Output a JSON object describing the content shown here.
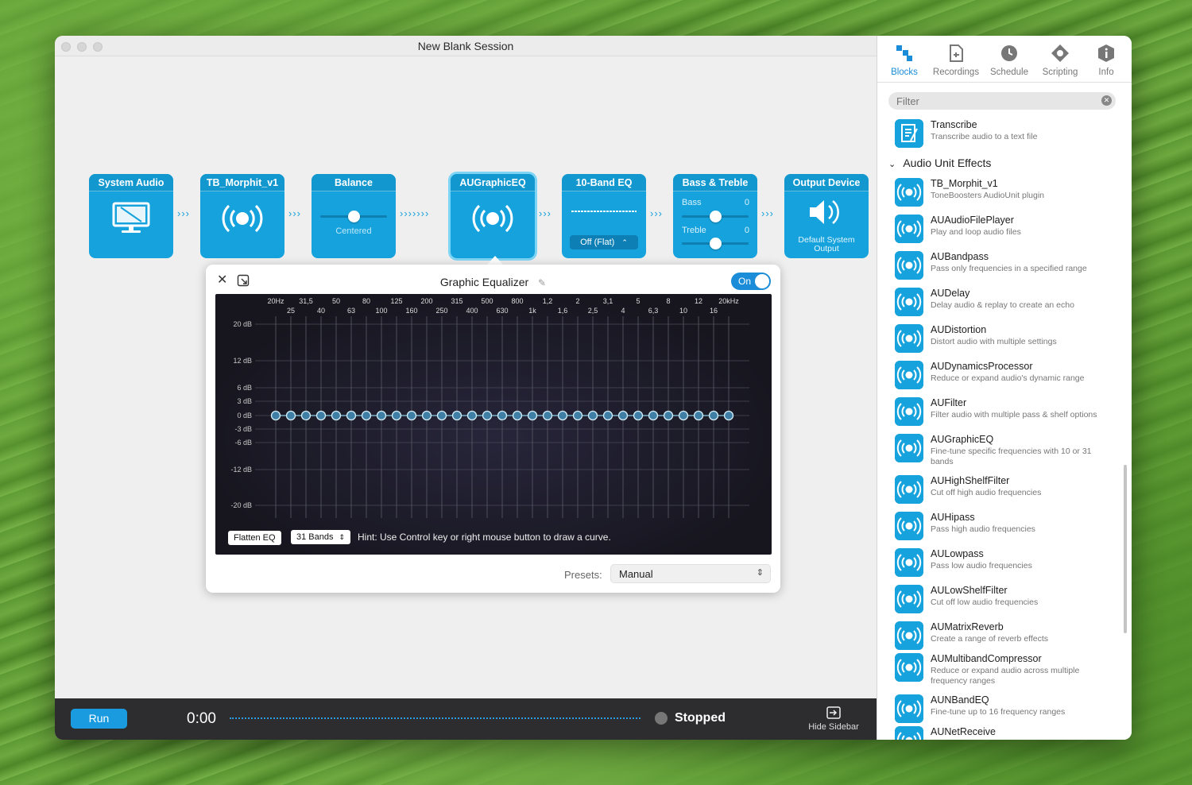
{
  "window": {
    "title": "New Blank Session"
  },
  "blocks": [
    {
      "title": "System Audio",
      "icon": "monitor-icon"
    },
    {
      "title": "TB_Morphit_v1",
      "icon": "audio-unit-icon"
    },
    {
      "title": "Balance",
      "value": "Centered"
    },
    {
      "title": "AUGraphicEQ",
      "icon": "audio-unit-icon"
    },
    {
      "title": "10-Band EQ",
      "preset": "Off (Flat)"
    },
    {
      "title": "Bass & Treble",
      "bass_label": "Bass",
      "bass_value": "0",
      "treble_label": "Treble",
      "treble_value": "0"
    },
    {
      "title": "Output Device",
      "subtitle": "Default System Output",
      "icon": "speaker-icon"
    }
  ],
  "eq": {
    "title": "Graphic Equalizer",
    "toggle_label": "On",
    "freq_top": [
      "20Hz",
      "31,5",
      "50",
      "80",
      "125",
      "200",
      "315",
      "500",
      "800",
      "1,2",
      "2",
      "3,1",
      "5",
      "8",
      "12",
      "20kHz"
    ],
    "freq_bottom": [
      "25",
      "40",
      "63",
      "100",
      "160",
      "250",
      "400",
      "630",
      "1k",
      "1,6",
      "2,5",
      "4",
      "6,3",
      "10",
      "16"
    ],
    "db_labels": [
      "20 dB",
      "12 dB",
      "6 dB",
      "3 dB",
      "0 dB",
      "-3 dB",
      "-6 dB",
      "-12 dB",
      "-20 dB"
    ],
    "band_gains_db": [
      0,
      0,
      0,
      0,
      0,
      0,
      0,
      0,
      0,
      0,
      0,
      0,
      0,
      0,
      0,
      0,
      0,
      0,
      0,
      0,
      0,
      0,
      0,
      0,
      0,
      0,
      0,
      0,
      0,
      0,
      0
    ],
    "flatten_label": "Flatten EQ",
    "bands_label": "31 Bands",
    "hint": "Hint: Use Control key or right mouse button to draw a curve.",
    "presets_label": "Presets:",
    "preset_value": "Manual"
  },
  "transport": {
    "run_label": "Run",
    "time": "0:00",
    "status": "Stopped",
    "hide_sidebar_label": "Hide Sidebar"
  },
  "sidebar": {
    "tabs": [
      {
        "label": "Blocks",
        "icon": "blocks-icon"
      },
      {
        "label": "Recordings",
        "icon": "recordings-icon"
      },
      {
        "label": "Schedule",
        "icon": "clock-icon"
      },
      {
        "label": "Scripting",
        "icon": "scripting-icon"
      },
      {
        "label": "Info",
        "icon": "info-icon"
      }
    ],
    "filter_placeholder": "Filter",
    "transcribe": {
      "name": "Transcribe",
      "desc": "Transcribe audio to a text file"
    },
    "section_title": "Audio Unit Effects",
    "items": [
      {
        "name": "TB_Morphit_v1",
        "desc": "ToneBoosters AudioUnit plugin"
      },
      {
        "name": "AUAudioFilePlayer",
        "desc": "Play and loop audio files"
      },
      {
        "name": "AUBandpass",
        "desc": "Pass only frequencies in a specified range"
      },
      {
        "name": "AUDelay",
        "desc": "Delay audio & replay to create an echo"
      },
      {
        "name": "AUDistortion",
        "desc": "Distort audio with multiple settings"
      },
      {
        "name": "AUDynamicsProcessor",
        "desc": "Reduce or expand audio's dynamic range"
      },
      {
        "name": "AUFilter",
        "desc": "Filter audio with multiple pass & shelf options"
      },
      {
        "name": "AUGraphicEQ",
        "desc": "Fine-tune specific frequencies with 10 or 31 bands"
      },
      {
        "name": "AUHighShelfFilter",
        "desc": "Cut off high audio frequencies"
      },
      {
        "name": "AUHipass",
        "desc": "Pass high audio frequencies"
      },
      {
        "name": "AULowpass",
        "desc": "Pass low audio frequencies"
      },
      {
        "name": "AULowShelfFilter",
        "desc": "Cut off low audio frequencies"
      },
      {
        "name": "AUMatrixReverb",
        "desc": "Create a range of reverb effects"
      },
      {
        "name": "AUMultibandCompressor",
        "desc": "Reduce or expand audio across multiple frequency ranges"
      },
      {
        "name": "AUNBandEQ",
        "desc": "Fine-tune up to 16 frequency ranges"
      },
      {
        "name": "AUNetReceive",
        "desc": ""
      }
    ]
  }
}
